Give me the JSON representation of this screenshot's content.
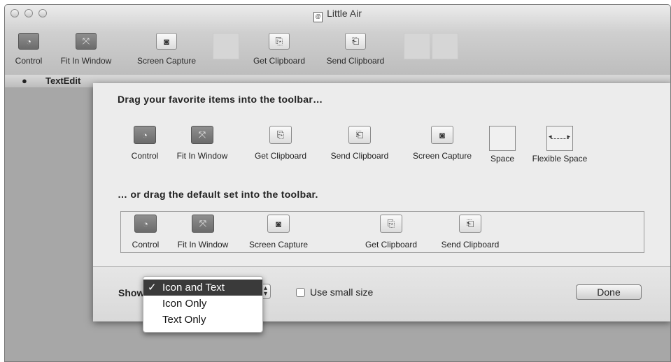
{
  "window": {
    "title": "Little Air"
  },
  "toolbar": {
    "items": [
      {
        "label": "Control",
        "icon": "control-icon"
      },
      {
        "label": "Fit In Window",
        "icon": "fit-window-icon"
      },
      {
        "label": "Screen Capture",
        "icon": "camera-icon"
      },
      {
        "label": "Get Clipboard",
        "icon": "get-clipboard-icon"
      },
      {
        "label": "Send Clipboard",
        "icon": "send-clipboard-icon"
      }
    ]
  },
  "menubar": {
    "apple": "",
    "app": "TextEdit"
  },
  "sheet": {
    "favorites_heading": "Drag your favorite items into the toolbar…",
    "favorites": [
      {
        "label": "Control",
        "icon": "control-icon"
      },
      {
        "label": "Fit In Window",
        "icon": "fit-window-icon"
      },
      {
        "label": "Get Clipboard",
        "icon": "get-clipboard-icon"
      },
      {
        "label": "Send Clipboard",
        "icon": "send-clipboard-icon"
      },
      {
        "label": "Screen Capture",
        "icon": "camera-icon"
      },
      {
        "label": "Space",
        "icon": "space-icon"
      },
      {
        "label": "Flexible Space",
        "icon": "flexible-space-icon"
      }
    ],
    "default_heading": "… or drag the default set into the toolbar.",
    "default_set": [
      {
        "label": "Control",
        "icon": "control-icon"
      },
      {
        "label": "Fit In Window",
        "icon": "fit-window-icon"
      },
      {
        "label": "Screen Capture",
        "icon": "camera-icon"
      },
      {
        "label": "Get Clipboard",
        "icon": "get-clipboard-icon"
      },
      {
        "label": "Send Clipboard",
        "icon": "send-clipboard-icon"
      }
    ],
    "show_label": "Show",
    "small_size_label": "Use small size",
    "done_label": "Done"
  },
  "show_menu": {
    "options": [
      "Icon and Text",
      "Icon Only",
      "Text Only"
    ],
    "selected": "Icon and Text",
    "check_mark": "✓"
  }
}
